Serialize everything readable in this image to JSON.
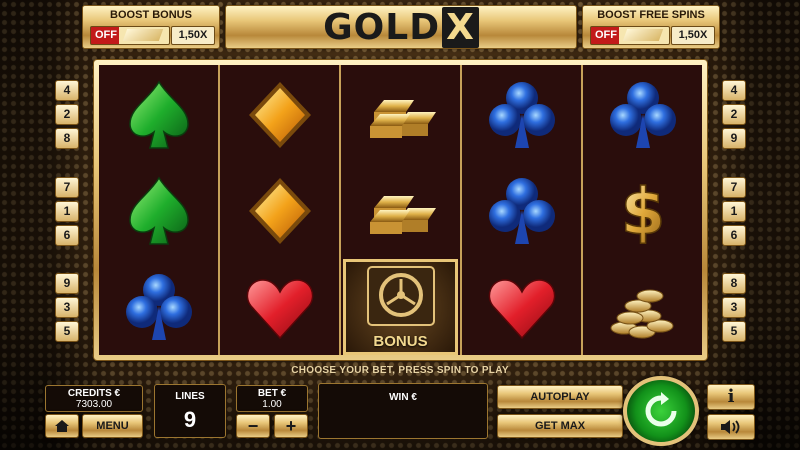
{
  "logo": {
    "text": "GOLD",
    "x": "X"
  },
  "boost_bonus": {
    "title": "BOOST BONUS",
    "state": "OFF",
    "multiplier": "1,50X"
  },
  "boost_free_spins": {
    "title": "BOOST FREE SPINS",
    "state": "OFF",
    "multiplier": "1,50X"
  },
  "paylines_left": [
    "4",
    "2",
    "8",
    "7",
    "1",
    "6",
    "9",
    "3",
    "5"
  ],
  "paylines_right": [
    "4",
    "2",
    "9",
    "7",
    "1",
    "6",
    "8",
    "3",
    "5"
  ],
  "reels": [
    [
      "green-spade",
      "green-spade",
      "blue-club"
    ],
    [
      "orange-diamond",
      "orange-diamond",
      "red-heart"
    ],
    [
      "gold-bars",
      "gold-bars",
      "bonus-safe"
    ],
    [
      "blue-club",
      "blue-club",
      "red-heart"
    ],
    [
      "blue-club",
      "gold-dollar",
      "gold-coins"
    ]
  ],
  "bonus_label": "BONUS",
  "hint": "CHOOSE YOUR BET, PRESS SPIN TO PLAY",
  "credits": {
    "label": "CREDITS €",
    "value": "7303.00"
  },
  "menu_label": "MENU",
  "lines": {
    "label": "LINES",
    "value": "9"
  },
  "bet": {
    "label": "BET €",
    "value": "1.00",
    "minus": "−",
    "plus": "+"
  },
  "win": {
    "label": "WIN €"
  },
  "autoplay_label": "AUTOPLAY",
  "getmax_label": "GET MAX",
  "info_label": "i",
  "colors": {
    "gold": "#e8c678",
    "reel_bg": "#2a0d0c",
    "spin_green": "#12911a",
    "off_red": "#c21a1a"
  }
}
